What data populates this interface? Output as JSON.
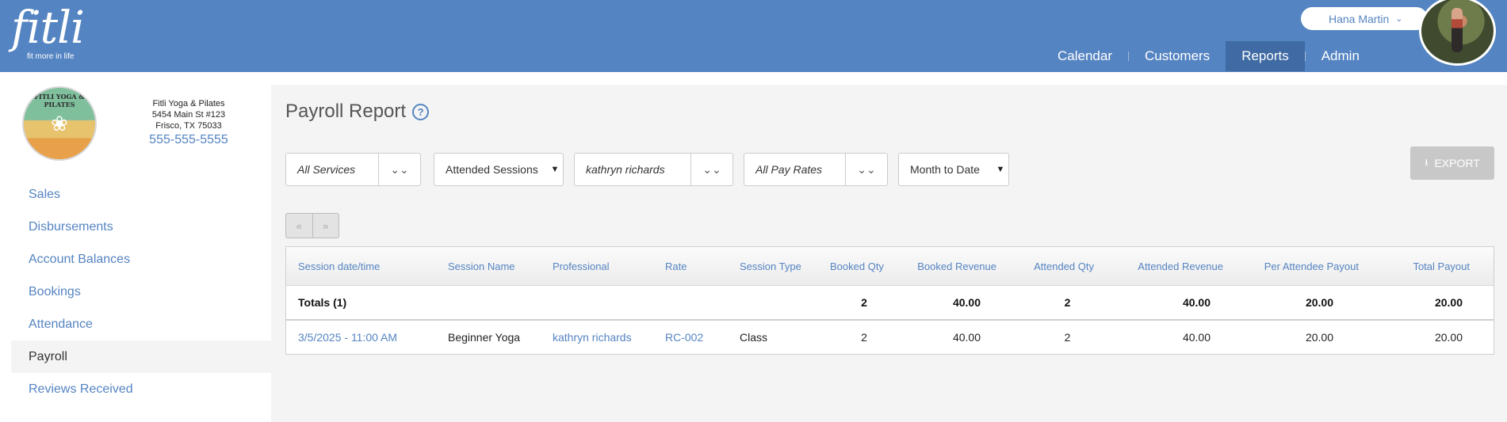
{
  "header": {
    "logo_text": "fitli",
    "logo_tagline": "fit more in life",
    "user_name": "Hana Martin",
    "nav": [
      "Calendar",
      "Customers",
      "Reports",
      "Admin"
    ],
    "active_nav": "Reports"
  },
  "business": {
    "logo_text": "FITLI YOGA & PILATES",
    "name": "Fitli Yoga & Pilates",
    "address_line1": "5454 Main St #123",
    "address_line2": "Frisco, TX 75033",
    "phone": "555-555-5555"
  },
  "sidebar": {
    "items": [
      "Sales",
      "Disbursements",
      "Account Balances",
      "Bookings",
      "Attendance",
      "Payroll",
      "Reviews Received"
    ],
    "active": "Payroll"
  },
  "page": {
    "title": "Payroll Report",
    "help": "?"
  },
  "filters": {
    "services": "All Services",
    "sessions": "Attended Sessions",
    "professional": "kathryn richards",
    "pay_rates": "All Pay Rates",
    "period": "Month to Date"
  },
  "export_label": "EXPORT",
  "pager": {
    "prev": "«",
    "next": "»"
  },
  "table": {
    "headers": [
      "Session date/time",
      "Session Name",
      "Professional",
      "Rate",
      "Session Type",
      "Booked Qty",
      "Booked Revenue",
      "Attended Qty",
      "Attended Revenue",
      "Per Attendee Payout",
      "Total Payout"
    ],
    "totals": [
      "Totals (1)",
      "",
      "",
      "",
      "",
      "2",
      "40.00",
      "2",
      "40.00",
      "20.00",
      "20.00"
    ],
    "rows": [
      [
        "3/5/2025 - 11:00 AM",
        "Beginner Yoga",
        "kathryn richards",
        "RC-002",
        "Class",
        "2",
        "40.00",
        "2",
        "40.00",
        "20.00",
        "20.00"
      ]
    ]
  },
  "colors": {
    "brand_blue": "#5584c2",
    "nav_active": "#3f6aa3",
    "content_bg": "#f4f4f4"
  },
  "icons": [
    "help-icon",
    "chevron-double-down-icon",
    "select-caret-icon",
    "download-icon",
    "user-chevron-icon"
  ]
}
